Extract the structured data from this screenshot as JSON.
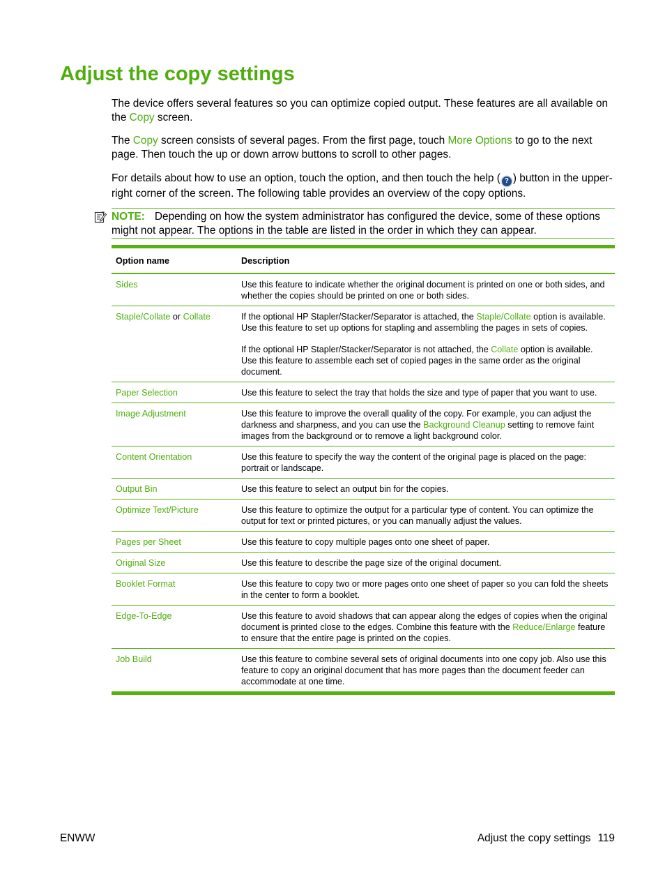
{
  "page": {
    "title": "Adjust the copy settings",
    "accent_color": "#4fae0d"
  },
  "intro": {
    "p1": {
      "a": "The device offers several features so you can optimize copied output. These features are all available on the ",
      "link": "Copy",
      "b": " screen."
    },
    "p2": {
      "a": "The ",
      "link1": "Copy",
      "b": " screen consists of several pages. From the first page, touch ",
      "link2": "More Options",
      "c": " to go to the next page. Then touch the up or down arrow buttons to scroll to other pages."
    },
    "p3": {
      "a": "For details about how to use an option, touch the option, and then touch the help (",
      "icon": "?",
      "b": ") button in the upper-right corner of the screen. The following table provides an overview of the copy options."
    }
  },
  "note": {
    "icon": "note-pad-icon",
    "label": "NOTE:",
    "text": "Depending on how the system administrator has configured the device, some of these options might not appear. The options in the table are listed in the order in which they can appear."
  },
  "table": {
    "headers": [
      "Option name",
      "Description"
    ],
    "rows": [
      {
        "name": "Sides",
        "desc": "Use this feature to indicate whether the original document is printed on one or both sides, and whether the copies should be printed on one or both sides."
      },
      {
        "name_a": "Staple/Collate",
        "name_or": " or ",
        "name_b": "Collate",
        "desc1_a": "If the optional HP Stapler/Stacker/Separator is attached, the ",
        "desc1_link": "Staple/Collate",
        "desc1_b": " option is available. Use this feature to set up options for stapling and assembling the pages in sets of copies.",
        "desc2_a": "If the optional HP Stapler/Stacker/Separator is not attached, the ",
        "desc2_link": "Collate",
        "desc2_b": " option is available. Use this feature to assemble each set of copied pages in the same order as the original document."
      },
      {
        "name": "Paper Selection",
        "desc": "Use this feature to select the tray that holds the size and type of paper that you want to use."
      },
      {
        "name": "Image Adjustment",
        "desc_a": "Use this feature to improve the overall quality of the copy. For example, you can adjust the darkness and sharpness, and you can use the ",
        "desc_link": "Background Cleanup",
        "desc_b": " setting to remove faint images from the background or to remove a light background color."
      },
      {
        "name": "Content Orientation",
        "desc": "Use this feature to specify the way the content of the original page is placed on the page: portrait or landscape."
      },
      {
        "name": "Output Bin",
        "desc": "Use this feature to select an output bin for the copies."
      },
      {
        "name": "Optimize Text/Picture",
        "desc": "Use this feature to optimize the output for a particular type of content. You can optimize the output for text or printed pictures, or you can manually adjust the values."
      },
      {
        "name": "Pages per Sheet",
        "desc": "Use this feature to copy multiple pages onto one sheet of paper."
      },
      {
        "name": "Original Size",
        "desc": "Use this feature to describe the page size of the original document."
      },
      {
        "name": "Booklet Format",
        "desc": "Use this feature to copy two or more pages onto one sheet of paper so you can fold the sheets in the center to form a booklet."
      },
      {
        "name": "Edge-To-Edge",
        "desc_a": "Use this feature to avoid shadows that can appear along the edges of copies when the original document is printed close to the edges. Combine this feature with the ",
        "desc_link": "Reduce/Enlarge",
        "desc_b": " feature to ensure that the entire page is printed on the copies."
      },
      {
        "name": "Job Build",
        "desc": "Use this feature to combine several sets of original documents into one copy job. Also use this feature to copy an original document that has more pages than the document feeder can accommodate at one time."
      }
    ]
  },
  "footer": {
    "left": "ENWW",
    "section": "Adjust the copy settings",
    "page_number": "119"
  }
}
